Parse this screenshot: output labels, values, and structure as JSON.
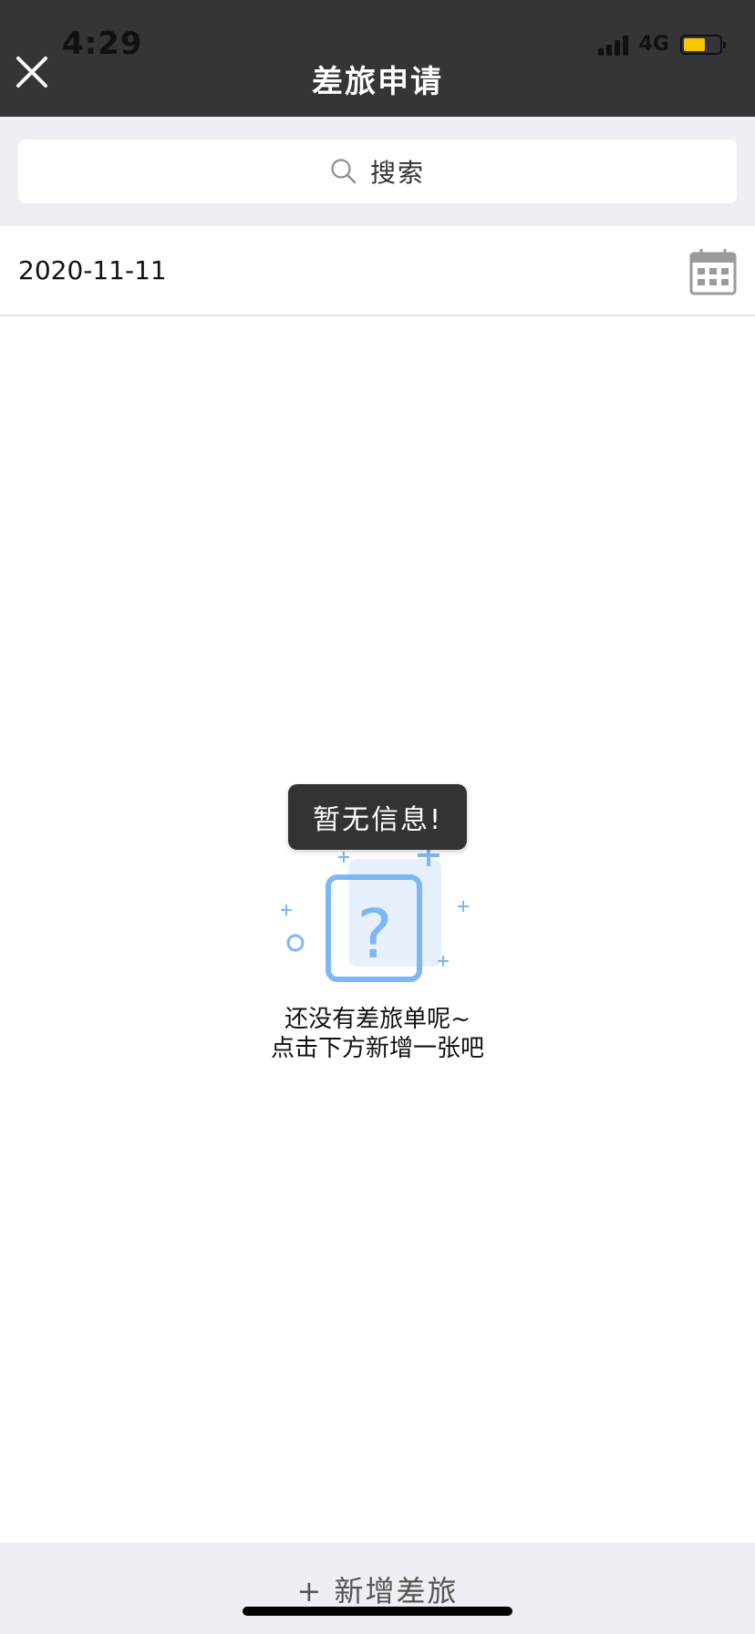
{
  "status_bar": {
    "time": "4:29",
    "network": "4G",
    "battery_color": "#f7c600"
  },
  "header": {
    "title": "差旅申请",
    "background": "#343439"
  },
  "search": {
    "placeholder": "搜索"
  },
  "date_filter": {
    "value": "2020-11-11"
  },
  "toast": {
    "message": "暂无信息!"
  },
  "empty_state": {
    "line1": "还没有差旅单呢~",
    "line2": "点击下方新增一张吧",
    "icon_color": "#7db7f5"
  },
  "footer": {
    "add_label": "+ 新增差旅"
  }
}
